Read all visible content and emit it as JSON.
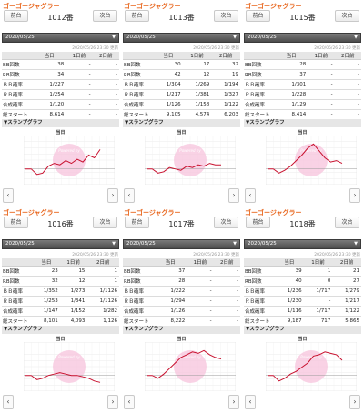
{
  "common": {
    "machine": "ゴーゴージャグラー",
    "prev": "前台",
    "next": "次台",
    "date": "2020/05/25",
    "updated": "2020/05/26 23:30 更新",
    "cols": [
      "当日",
      "1日前",
      "2日前"
    ],
    "rowlabels": [
      "BB回数",
      "RB回数",
      "ＢＢ確率",
      "ＲＢ確率",
      "合成確率",
      "総スタート"
    ],
    "graph_title": "▼スランプグラフ",
    "graph_sub": "当日",
    "watermark": "Powered by",
    "left_icon": "chevron-left-icon",
    "right_icon": "chevron-right-icon"
  },
  "panels": [
    {
      "number": "1012番",
      "rows": [
        [
          "38",
          "-",
          "-"
        ],
        [
          "34",
          "-",
          "-"
        ],
        [
          "1/227",
          "-",
          "-"
        ],
        [
          "1/254",
          "-",
          "-"
        ],
        [
          "1/120",
          "-",
          "-"
        ],
        [
          "8,614",
          "-",
          "-"
        ]
      ],
      "slump": [
        0,
        0,
        -4,
        -3,
        2,
        4,
        3,
        6,
        4,
        7,
        5,
        10,
        8,
        14
      ]
    },
    {
      "number": "1013番",
      "rows": [
        [
          "30",
          "17",
          "32"
        ],
        [
          "42",
          "12",
          "19"
        ],
        [
          "1/304",
          "1/269",
          "1/194"
        ],
        [
          "1/217",
          "1/381",
          "1/327"
        ],
        [
          "1/126",
          "1/158",
          "1/122"
        ],
        [
          "9,105",
          "4,574",
          "6,203"
        ]
      ],
      "slump": [
        0,
        0,
        -3,
        -2,
        1,
        0,
        -1,
        2,
        1,
        3,
        2,
        4,
        3,
        3
      ]
    },
    {
      "number": "1015番",
      "rows": [
        [
          "28",
          "-",
          "-"
        ],
        [
          "37",
          "-",
          "-"
        ],
        [
          "1/301",
          "-",
          "-"
        ],
        [
          "1/228",
          "-",
          "-"
        ],
        [
          "1/129",
          "-",
          "-"
        ],
        [
          "8,414",
          "-",
          "-"
        ]
      ],
      "slump": [
        0,
        0,
        -3,
        -1,
        2,
        6,
        10,
        15,
        18,
        13,
        8,
        5,
        6,
        4
      ]
    },
    {
      "number": "1016番",
      "rows": [
        [
          "23",
          "15",
          "1"
        ],
        [
          "32",
          "12",
          "1"
        ],
        [
          "1/352",
          "1/273",
          "1/1126"
        ],
        [
          "1/253",
          "1/341",
          "1/1126"
        ],
        [
          "1/147",
          "1/152",
          "1/282"
        ],
        [
          "8,101",
          "4,093",
          "1,126"
        ]
      ],
      "slump": [
        0,
        0,
        -3,
        -2,
        0,
        1,
        2,
        1,
        0,
        0,
        -1,
        -2,
        -4,
        -5
      ]
    },
    {
      "number": "1017番",
      "rows": [
        [
          "37",
          "-",
          "-"
        ],
        [
          "28",
          "-",
          "-"
        ],
        [
          "1/222",
          "-",
          "-"
        ],
        [
          "1/294",
          "-",
          "-"
        ],
        [
          "1/126",
          "-",
          "-"
        ],
        [
          "8,222",
          "-",
          "-"
        ]
      ],
      "slump": [
        0,
        0,
        -2,
        1,
        5,
        9,
        13,
        15,
        17,
        16,
        18,
        15,
        13,
        12
      ]
    },
    {
      "number": "1018番",
      "rows": [
        [
          "39",
          "1",
          "21"
        ],
        [
          "40",
          "0",
          "27"
        ],
        [
          "1/236",
          "1/717",
          "1/279"
        ],
        [
          "1/230",
          "-",
          "1/217"
        ],
        [
          "1/116",
          "1/717",
          "1/122"
        ],
        [
          "9,187",
          "717",
          "5,865"
        ]
      ],
      "slump": [
        0,
        0,
        -4,
        -2,
        1,
        3,
        6,
        9,
        14,
        15,
        17,
        16,
        15,
        11
      ]
    }
  ]
}
